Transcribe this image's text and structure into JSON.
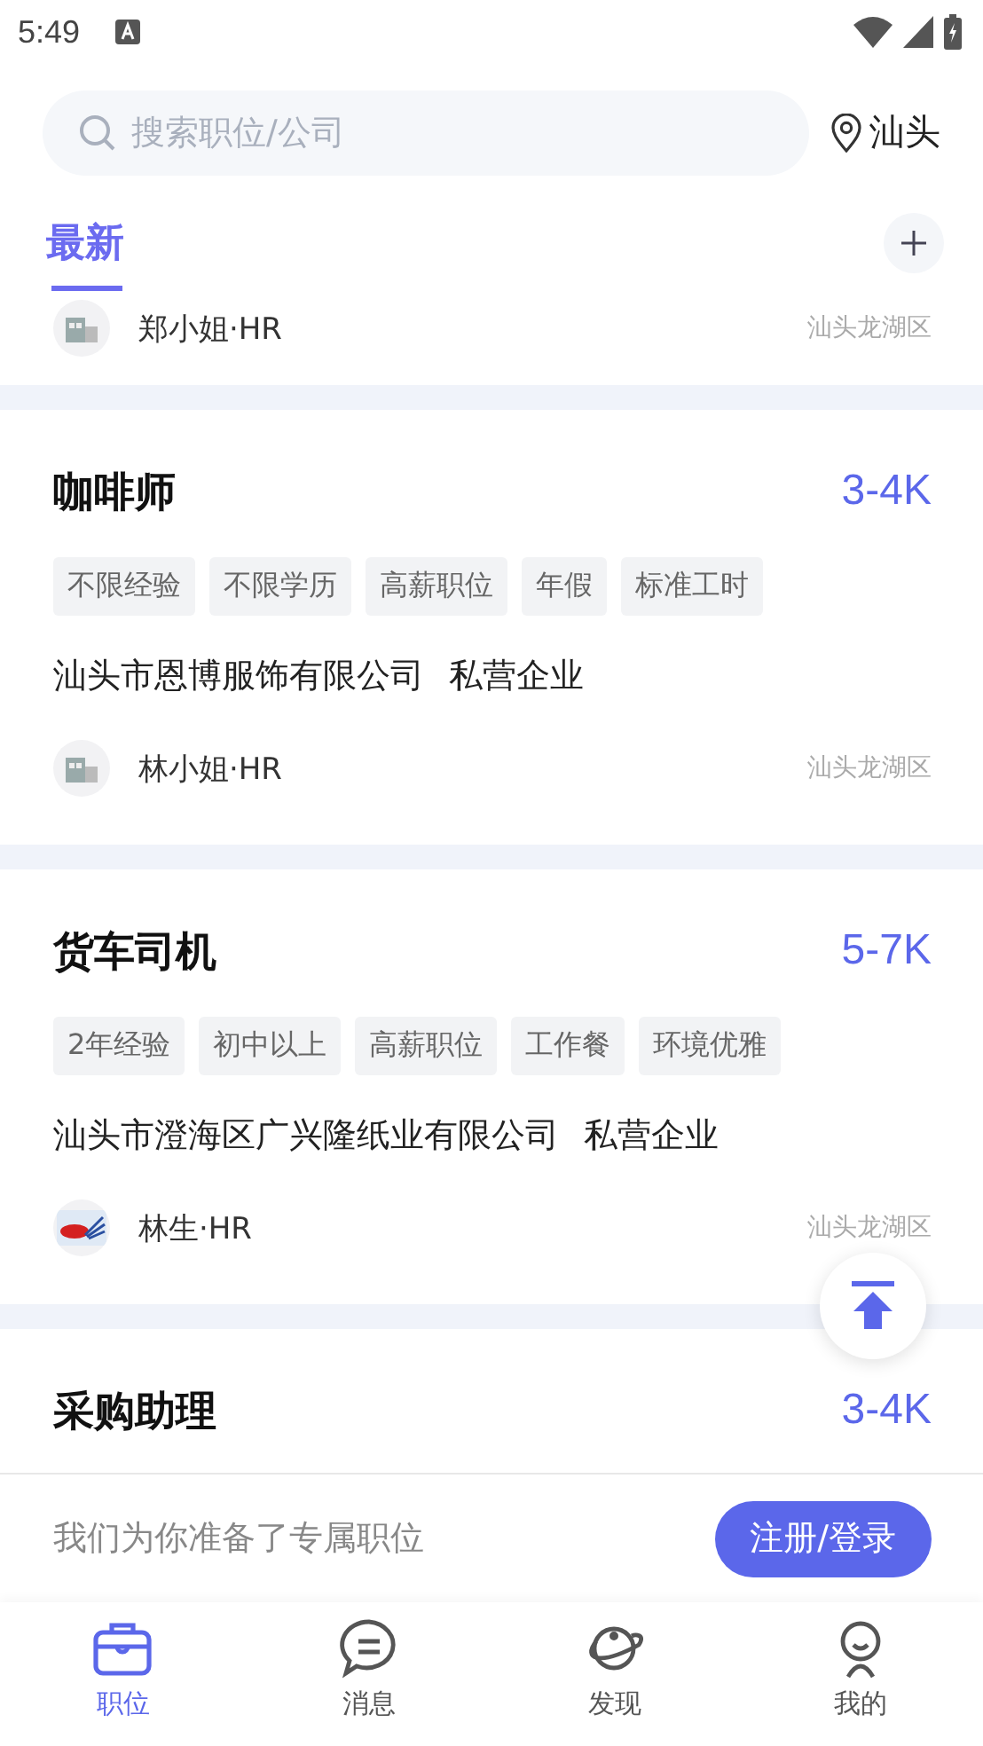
{
  "status_bar": {
    "time": "5:49"
  },
  "search": {
    "placeholder": "搜索职位/公司",
    "city": "汕头"
  },
  "section": {
    "title": "最新",
    "selected": true
  },
  "partial_card": {
    "hr": "郑小姐·HR",
    "location": "汕头龙湖区",
    "kind": "building"
  },
  "jobs": [
    {
      "title": "咖啡师",
      "salary": "3-4K",
      "tags": [
        "不限经验",
        "不限学历",
        "高薪职位",
        "年假",
        "标准工时"
      ],
      "company": "汕头市恩博服饰有限公司",
      "company_type": "私营企业",
      "hr": "林小姐·HR",
      "location": "汕头龙湖区",
      "kind": "building"
    },
    {
      "title": "货车司机",
      "salary": "5-7K",
      "tags": [
        "2年经验",
        "初中以上",
        "高薪职位",
        "工作餐",
        "环境优雅"
      ],
      "company": "汕头市澄海区广兴隆纸业有限公司",
      "company_type": "私营企业",
      "hr": "林生·HR",
      "location": "汕头龙湖区",
      "kind": "logo"
    },
    {
      "title": "采购助理",
      "salary": "3-4K"
    }
  ],
  "banner": {
    "text": "我们为你准备了专属职位",
    "button": "注册/登录"
  },
  "nav": [
    {
      "label": "职位",
      "selected": true
    },
    {
      "label": "消息",
      "selected": false
    },
    {
      "label": "发现",
      "selected": false
    },
    {
      "label": "我的",
      "selected": false
    }
  ]
}
